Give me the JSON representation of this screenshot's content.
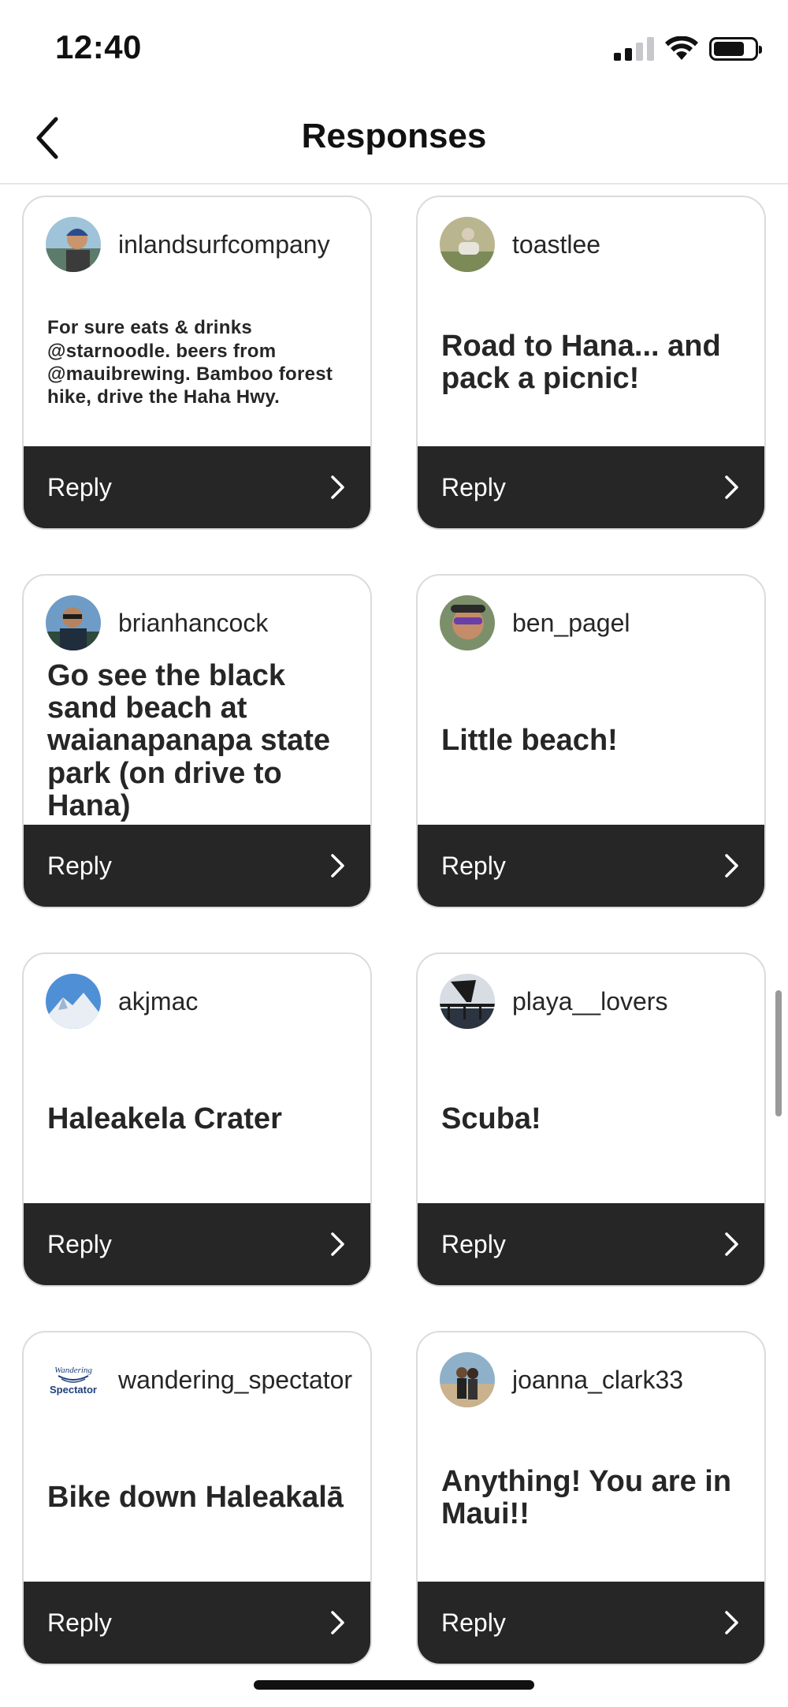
{
  "status_bar": {
    "time": "12:40",
    "icons": [
      "cellular-signal-icon",
      "wifi-icon",
      "battery-icon"
    ]
  },
  "nav": {
    "back_icon": "chevron-left-icon",
    "title": "Responses"
  },
  "cards": [
    {
      "username": "inlandsurfcompany",
      "text": "For sure eats & drinks @starnoodle. beers from @mauibrewing. Bamboo forest hike, drive the Haha Hwy.",
      "small": true,
      "reply": "Reply"
    },
    {
      "username": "toastlee",
      "text": "Road to Hana... and pack a picnic!",
      "small": false,
      "reply": "Reply"
    },
    {
      "username": "brianhancock",
      "text": "Go see the black sand beach at waianapanapa state park (on drive to Hana)",
      "small": false,
      "reply": "Reply"
    },
    {
      "username": "ben_pagel",
      "text": "Little beach!",
      "small": false,
      "reply": "Reply"
    },
    {
      "username": "akjmac",
      "text": "Haleakela Crater",
      "small": false,
      "reply": "Reply"
    },
    {
      "username": "playa__lovers",
      "text": "Scuba!",
      "small": false,
      "reply": "Reply"
    },
    {
      "username": "wandering_spectator",
      "text": "Bike down Haleakalā",
      "small": false,
      "reply": "Reply"
    },
    {
      "username": "joanna_clark33",
      "text": "Anything!  You are in Maui!!",
      "small": false,
      "reply": "Reply"
    }
  ],
  "logo_text": {
    "line1": "Wandering",
    "line2": "Spectator"
  },
  "colors": {
    "reply_bar": "#262626",
    "card_border": "#dbdbdb",
    "text": "#262626"
  }
}
